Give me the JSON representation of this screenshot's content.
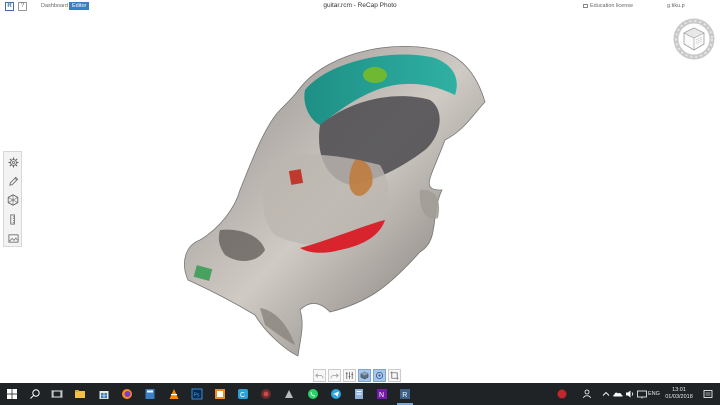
{
  "app": {
    "logo": "R",
    "help": "?",
    "title": "guitar.rcm - ReCap Photo",
    "nav": {
      "dashboard": "Dashboard",
      "editor": "Editor"
    },
    "license": "Education license",
    "user": "g.tiku.p"
  },
  "left_tools": [
    {
      "name": "settings-tool",
      "icon": "gear-icon"
    },
    {
      "name": "edit-tool",
      "icon": "pencil-icon"
    },
    {
      "name": "mesh-tool",
      "icon": "hexagon-icon"
    },
    {
      "name": "measure-tool",
      "icon": "ruler-icon"
    },
    {
      "name": "export-tool",
      "icon": "image-icon"
    }
  ],
  "bottom_tools": [
    {
      "name": "undo",
      "icon": "undo-icon",
      "active": false
    },
    {
      "name": "redo",
      "icon": "redo-icon",
      "active": false
    },
    {
      "name": "adjust",
      "icon": "sliders-icon",
      "active": false
    },
    {
      "name": "shaded-view",
      "icon": "cube-icon",
      "active": true
    },
    {
      "name": "orbit",
      "icon": "orbit-icon",
      "active": true
    },
    {
      "name": "crop",
      "icon": "crop-icon",
      "active": false
    }
  ],
  "taskbar": {
    "language": "ENG",
    "time": "13:01",
    "date": "01/03/2018",
    "apps": [
      "start",
      "search",
      "task-view",
      "file-explorer",
      "store",
      "firefox",
      "calculator",
      "vlc",
      "photoshop",
      "app-orange",
      "ccleaner",
      "app-dark",
      "app-gray",
      "whatsapp",
      "telegram",
      "app-bluegray",
      "onenote",
      "recap"
    ]
  },
  "colors": {
    "accent": "#3a7fc4",
    "taskbar": "#1f2326",
    "tool_active": "#a9c7e6"
  }
}
